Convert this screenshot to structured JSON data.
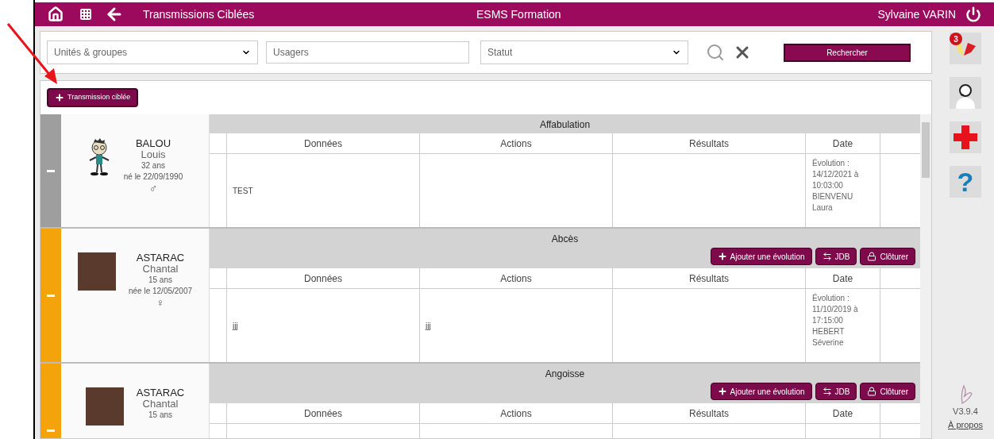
{
  "top_bar": {
    "title": "Transmissions Ciblées",
    "center": "ESMS Formation",
    "user": "Sylvaine VARIN"
  },
  "filters": {
    "units": {
      "placeholder": "Unités & groupes"
    },
    "users": {
      "placeholder": "Usagers"
    },
    "status": {
      "placeholder": "Statut"
    },
    "search_button": "Rechercher"
  },
  "add_button": "Transmission ciblée",
  "records": [
    {
      "color": "#9e9e9e",
      "kind": "cartoon",
      "last_name": "BALOU",
      "first_name": "Louis",
      "age": "32 ans",
      "birth": "né le 22/09/1990",
      "sex": "♂",
      "target": "Affabulation",
      "columns": [
        "Données",
        "Actions",
        "Résultats",
        "Date"
      ],
      "data": "TEST",
      "date": [
        "Évolution :",
        "14/12/2021 à",
        "10:03:00",
        "BIENVENU",
        "Laura"
      ]
    },
    {
      "color": "#f5a30a",
      "kind": "photo",
      "last_name": "ASTARAC",
      "first_name": "Chantal",
      "age": "15 ans",
      "birth": "née le 12/05/2007",
      "sex": "♀",
      "target": "Abcès",
      "buttons": [
        {
          "kind": "add",
          "label": "Ajouter une évolution"
        },
        {
          "kind": "jdb",
          "label": "JDB"
        },
        {
          "kind": "close",
          "label": "Clôturer"
        }
      ],
      "columns": [
        "Données",
        "Actions",
        "Résultats",
        "Date"
      ],
      "data": "jjj",
      "actions": "jjj",
      "date": [
        "Évolution :",
        "11/10/2019 à",
        "17:15:00",
        "HEBERT",
        "Séverine"
      ]
    },
    {
      "color": "#f5a30a",
      "kind": "photo",
      "last_name": "ASTARAC",
      "first_name": "Chantal",
      "age": "15 ans",
      "target": "Angoisse",
      "buttons": [
        {
          "kind": "add",
          "label": "Ajouter une évolution"
        },
        {
          "kind": "jdb",
          "label": "JDB"
        },
        {
          "kind": "close",
          "label": "Clôturer"
        }
      ],
      "columns": [
        "Données",
        "Actions",
        "Résultats",
        "Date"
      ]
    }
  ],
  "sidebar": {
    "notification_count": "3",
    "help_glyph": "?",
    "version": "V3.9.4",
    "about_link": "À propos"
  }
}
